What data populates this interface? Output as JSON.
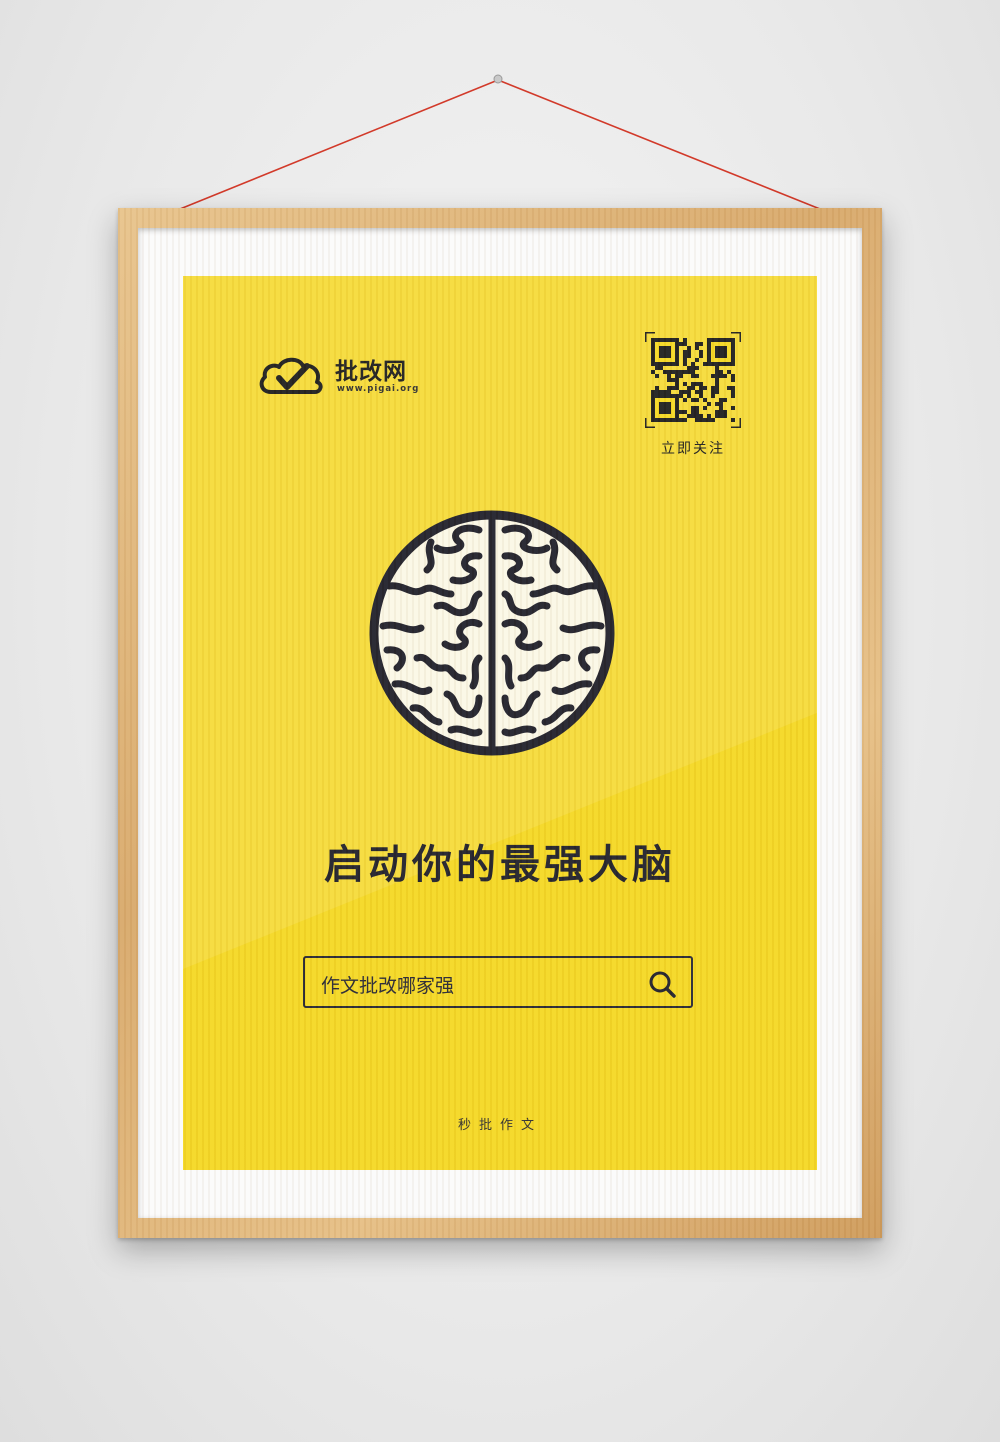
{
  "logo": {
    "name": "批改网",
    "url": "www.pigai.org"
  },
  "qr": {
    "caption": "立即关注"
  },
  "headline": "启动你的最强大脑",
  "search": {
    "text": "作文批改哪家强"
  },
  "tagline": "秒批作文",
  "colors": {
    "poster": "#f5d826",
    "ink": "#24242e",
    "brain_fill": "#fbf8e6",
    "frame_wood": "#dcae70",
    "string": "#d23a2a"
  },
  "icons": [
    "cloud-check-icon",
    "qr-code-icon",
    "brain-icon",
    "search-icon"
  ]
}
